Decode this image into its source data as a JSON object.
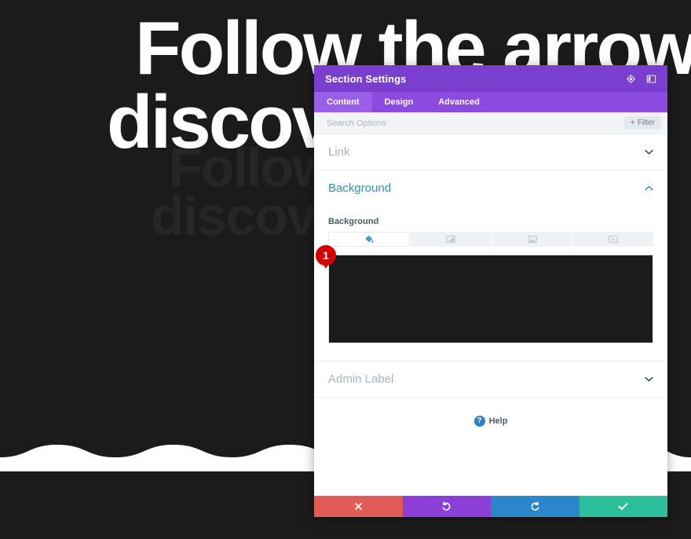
{
  "canvas": {
    "hero_line_1": "Follow the arrows",
    "hero_line_2": "discover",
    "ghost_line_1": "Follow",
    "ghost_line_2": "discover",
    "background_color": "#1b1b1b",
    "wave_color": "#ffffff"
  },
  "modal": {
    "title": "Section Settings",
    "title_icons": [
      {
        "name": "settings-target-icon"
      },
      {
        "name": "panel-layout-icon"
      }
    ],
    "tabs": [
      {
        "label": "Content",
        "active": true
      },
      {
        "label": "Design",
        "active": false
      },
      {
        "label": "Advanced",
        "active": false
      }
    ],
    "search": {
      "placeholder": "Search Options",
      "value": ""
    },
    "filter_button": {
      "label": "Filter",
      "plus": "+"
    },
    "sections": [
      {
        "label": "Link",
        "open": false
      },
      {
        "label": "Background",
        "open": true
      },
      {
        "label": "Admin Label",
        "open": false
      }
    ],
    "background": {
      "field_label": "Background",
      "types": [
        {
          "name": "background-color-tab",
          "icon": "paint-bucket-icon",
          "active": true
        },
        {
          "name": "background-gradient-tab",
          "icon": "gradient-icon",
          "active": false
        },
        {
          "name": "background-image-tab",
          "icon": "image-icon",
          "active": false
        },
        {
          "name": "background-video-tab",
          "icon": "video-icon",
          "active": false
        }
      ],
      "selected_color": "#1b1b1b"
    },
    "step_markers": [
      {
        "number": "1"
      }
    ],
    "help": {
      "label": "Help",
      "icon_glyph": "?"
    },
    "footer": [
      {
        "name": "cancel-button",
        "icon": "close-icon",
        "color": "#e25c57"
      },
      {
        "name": "undo-button",
        "icon": "undo-icon",
        "color": "#8c3fd6"
      },
      {
        "name": "redo-button",
        "icon": "redo-icon",
        "color": "#2b86ca"
      },
      {
        "name": "save-button",
        "icon": "check-icon",
        "color": "#2dbe9b"
      }
    ]
  }
}
